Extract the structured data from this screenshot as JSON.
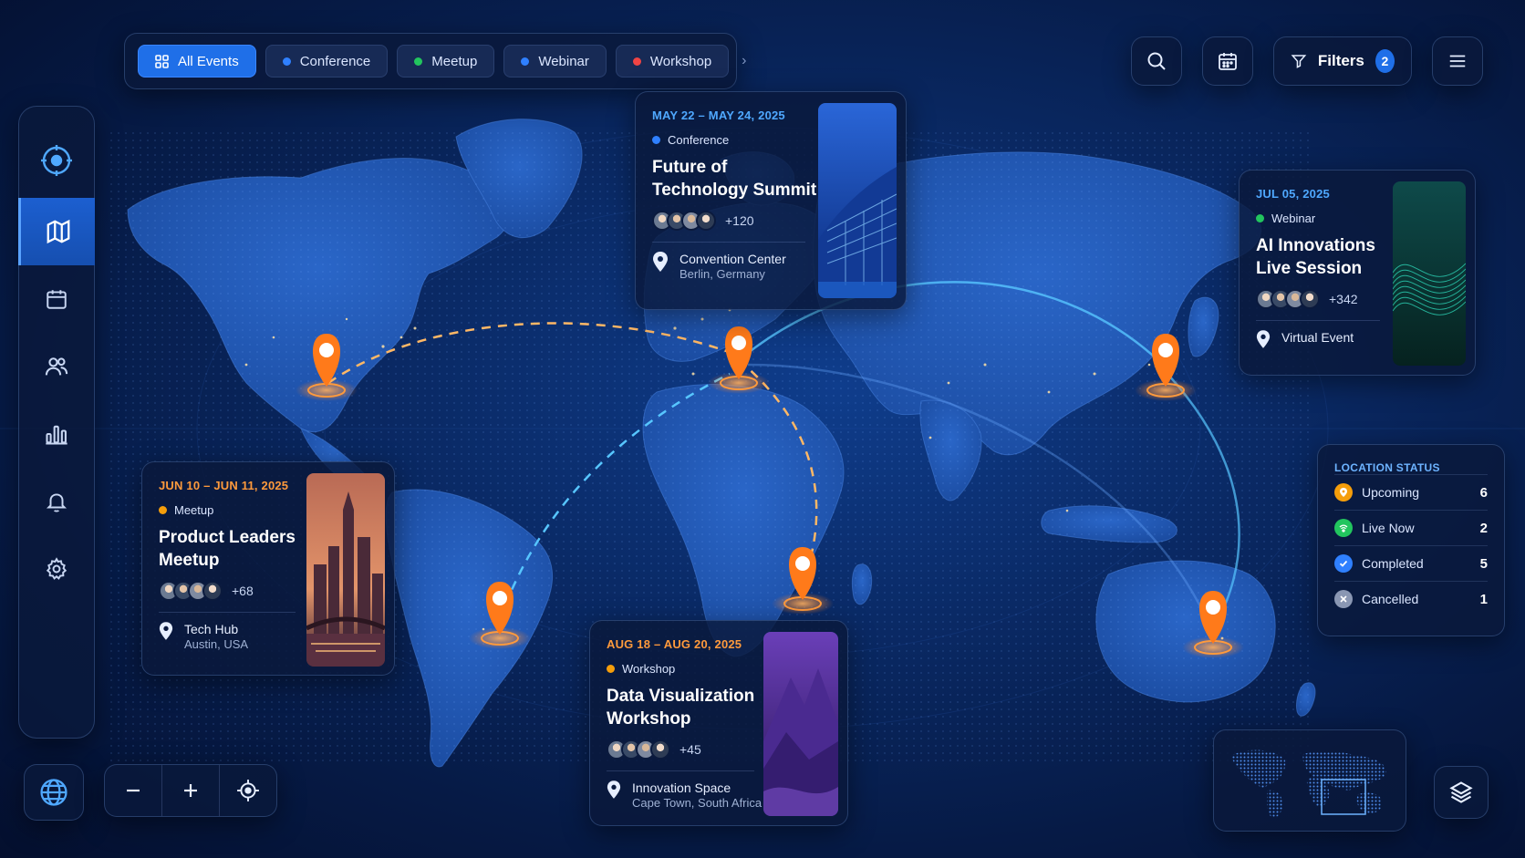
{
  "filters": {
    "tabs": [
      {
        "label": "All Events",
        "color": "#ffffff",
        "active": true
      },
      {
        "label": "Conference",
        "color": "#2f80ff",
        "active": false
      },
      {
        "label": "Meetup",
        "color": "#22c55e",
        "active": false
      },
      {
        "label": "Webinar",
        "color": "#2f80ff",
        "active": false
      },
      {
        "label": "Workshop",
        "color": "#ef4444",
        "active": false
      }
    ]
  },
  "toolbar": {
    "filters_label": "Filters",
    "filters_count": "2"
  },
  "events": [
    {
      "date": "MAY 22 – MAY 24, 2025",
      "type": "Conference",
      "title_line1": "Future of",
      "title_line2": "Technology Summit",
      "attendees": "+120",
      "venue": "Convention Center",
      "city": "Berlin, Germany"
    },
    {
      "date": "JUL 05, 2025",
      "type": "Webinar",
      "title_line1": "AI Innovations",
      "title_line2": "Live Session",
      "attendees": "+342",
      "venue": "Virtual Event"
    },
    {
      "date": "JUN 10 – JUN 11, 2025",
      "type": "Meetup",
      "title_line1": "Product Leaders",
      "title_line2": "Meetup",
      "attendees": "+68",
      "venue": "Tech Hub",
      "city": "Austin, USA"
    },
    {
      "date": "AUG 18 – AUG 20, 2025",
      "type": "Workshop",
      "title_line1": "Data Visualization",
      "title_line2": "Workshop",
      "attendees": "+45",
      "venue": "Innovation Space",
      "city": "Cape Town, South Africa"
    }
  ],
  "status": {
    "title": "LOCATION STATUS",
    "rows": [
      {
        "label": "Upcoming",
        "count": "6",
        "color": "#f59e0b"
      },
      {
        "label": "Live Now",
        "count": "2",
        "color": "#22c55e"
      },
      {
        "label": "Completed",
        "count": "5",
        "color": "#2f80ff"
      },
      {
        "label": "Cancelled",
        "count": "1",
        "color": "#8a97b3"
      }
    ]
  },
  "colors": {
    "accent": "#1f6fe8",
    "pin": "#ff7a1a",
    "conference_date": "#4fa8ff",
    "webinar_date": "#4fa8ff",
    "meetup_date": "#ff9a3c",
    "workshop_date": "#ff9a3c",
    "conference_dot": "#2f80ff",
    "webinar_dot": "#22c55e",
    "meetup_dot": "#f59e0b",
    "workshop_dot": "#f59e0b"
  },
  "icons": {
    "sidebar": [
      "target-icon",
      "map-icon",
      "calendar-icon",
      "users-icon",
      "chart-icon",
      "bell-icon",
      "gear-icon"
    ],
    "toolbar": [
      "search-icon",
      "calendar-icon",
      "filter-icon",
      "menu-icon"
    ],
    "bottom": [
      "globe-icon",
      "minus-icon",
      "plus-icon",
      "locate-icon",
      "layers-icon"
    ]
  }
}
